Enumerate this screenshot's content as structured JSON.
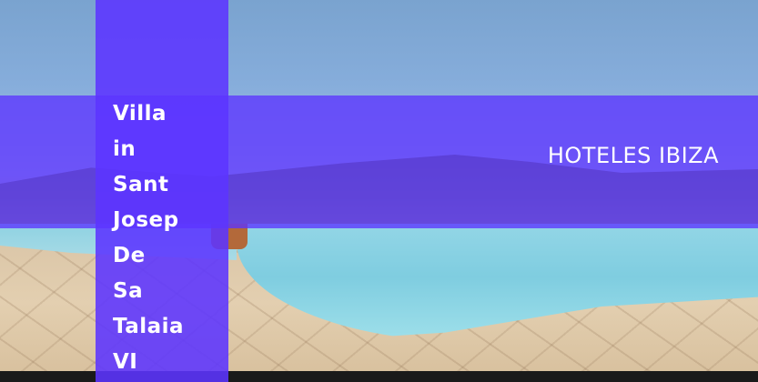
{
  "title_words": [
    "Villa",
    "in",
    "Sant",
    "Josep",
    "De",
    "Sa",
    "Talaia",
    "VI"
  ],
  "brand": "HOTELES IBIZA",
  "colors": {
    "overlay": "#5c34ff",
    "text": "#ffffff"
  }
}
